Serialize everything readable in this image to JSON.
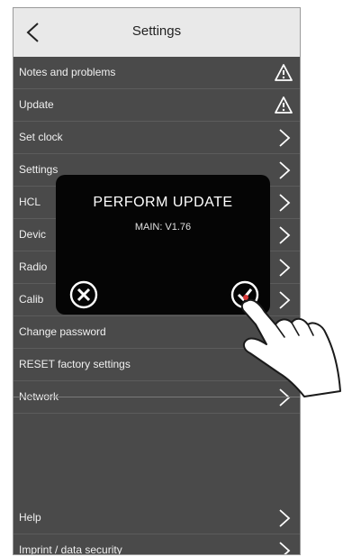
{
  "header": {
    "title": "Settings",
    "back_icon": "chevron-left-icon"
  },
  "menu": {
    "items": [
      {
        "label": "Notes and problems",
        "icon": "warning-icon"
      },
      {
        "label": "Update",
        "icon": "warning-icon"
      },
      {
        "label": "Set clock",
        "icon": "chevron-right-icon"
      },
      {
        "label": "Settings",
        "icon": "chevron-right-icon"
      },
      {
        "label": "HCL",
        "icon": "chevron-right-icon"
      },
      {
        "label": "Devic",
        "icon": "chevron-right-icon"
      },
      {
        "label": "Radio",
        "icon": "chevron-right-icon"
      },
      {
        "label": "Calib",
        "icon": "chevron-right-icon"
      },
      {
        "label": "Change password"
      },
      {
        "label": "RESET factory settings"
      },
      {
        "label": "Network",
        "icon": "chevron-right-icon"
      }
    ]
  },
  "footer": {
    "items": [
      {
        "label": "Help",
        "icon": "chevron-right-icon"
      },
      {
        "label": "Imprint / data security",
        "icon": "chevron-right-icon"
      }
    ]
  },
  "dialog": {
    "title": "PERFORM UPDATE",
    "subtitle": "MAIN: V1.76",
    "cancel_icon": "close-circle-icon",
    "confirm_icon": "check-circle-icon"
  },
  "overlay": {
    "hand_icon": "pointing-hand-icon"
  },
  "colors": {
    "panel": "#4a4a4a",
    "header": "#e9e9e9",
    "dialog": "#050505",
    "text": "#f0f0f0",
    "confirm_accent": "#d93a3a"
  }
}
